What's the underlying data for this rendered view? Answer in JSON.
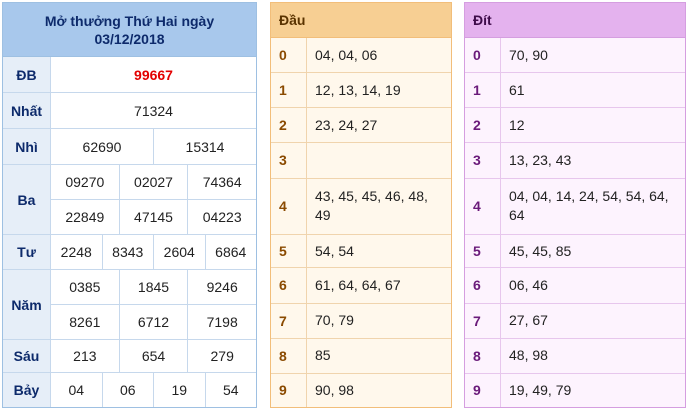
{
  "results": {
    "title_line1": "Mở thưởng Thứ Hai ngày",
    "title_line2": "03/12/2018",
    "prizes": [
      {
        "label": "ĐB",
        "lines": [
          [
            "99667"
          ]
        ]
      },
      {
        "label": "Nhất",
        "lines": [
          [
            "71324"
          ]
        ]
      },
      {
        "label": "Nhì",
        "lines": [
          [
            "62690",
            "15314"
          ]
        ]
      },
      {
        "label": "Ba",
        "lines": [
          [
            "09270",
            "02027",
            "74364"
          ],
          [
            "22849",
            "47145",
            "04223"
          ]
        ]
      },
      {
        "label": "Tư",
        "lines": [
          [
            "2248",
            "8343",
            "2604",
            "6864"
          ]
        ]
      },
      {
        "label": "Năm",
        "lines": [
          [
            "0385",
            "1845",
            "9246"
          ],
          [
            "8261",
            "6712",
            "7198"
          ]
        ]
      },
      {
        "label": "Sáu",
        "lines": [
          [
            "213",
            "654",
            "279"
          ]
        ]
      },
      {
        "label": "Bảy",
        "lines": [
          [
            "04",
            "06",
            "19",
            "54"
          ]
        ]
      }
    ]
  },
  "dau": {
    "header": "Đầu",
    "rows": [
      {
        "key": "0",
        "values": "04, 04, 06"
      },
      {
        "key": "1",
        "values": "12, 13, 14, 19"
      },
      {
        "key": "2",
        "values": "23, 24, 27"
      },
      {
        "key": "3",
        "values": ""
      },
      {
        "key": "4",
        "values": "43, 45, 45, 46, 48, 49"
      },
      {
        "key": "5",
        "values": "54, 54"
      },
      {
        "key": "6",
        "values": "61, 64, 64, 67"
      },
      {
        "key": "7",
        "values": "70, 79"
      },
      {
        "key": "8",
        "values": "85"
      },
      {
        "key": "9",
        "values": "90, 98"
      }
    ]
  },
  "dit": {
    "header": "Đít",
    "rows": [
      {
        "key": "0",
        "values": "70, 90"
      },
      {
        "key": "1",
        "values": "61"
      },
      {
        "key": "2",
        "values": "12"
      },
      {
        "key": "3",
        "values": "13, 23, 43"
      },
      {
        "key": "4",
        "values": "04, 04, 14, 24, 54, 54, 64, 64"
      },
      {
        "key": "5",
        "values": "45, 45, 85"
      },
      {
        "key": "6",
        "values": "06, 46"
      },
      {
        "key": "7",
        "values": "27, 67"
      },
      {
        "key": "8",
        "values": "48, 98"
      },
      {
        "key": "9",
        "values": "19, 49, 79"
      }
    ]
  },
  "colors": {
    "special_prize": "#e30000",
    "results_header": "#a8c8ec",
    "dau_header": "#f7cf93",
    "dit_header": "#e4b2ee"
  }
}
